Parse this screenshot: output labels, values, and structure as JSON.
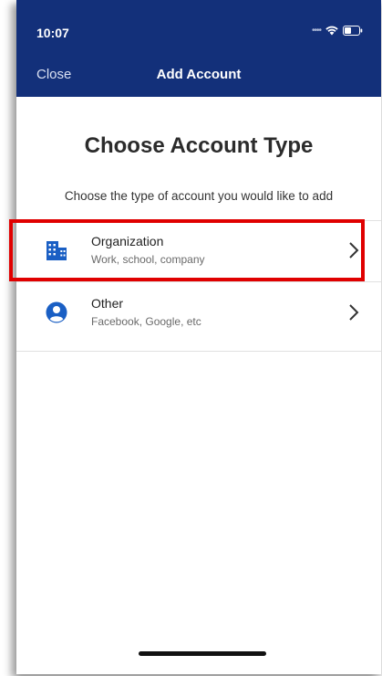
{
  "status_bar": {
    "time": "10:07"
  },
  "nav": {
    "close_label": "Close",
    "title": "Add Account"
  },
  "main": {
    "heading": "Choose Account Type",
    "subheading": "Choose the type of account you would like to add",
    "items": [
      {
        "title": "Organization",
        "subtitle": "Work, school, company",
        "icon": "building-icon",
        "highlighted": true
      },
      {
        "title": "Other",
        "subtitle": "Facebook, Google, etc",
        "icon": "person-icon",
        "highlighted": false
      }
    ]
  },
  "colors": {
    "header": "#13307a",
    "icon": "#1a5fc4",
    "highlight": "#e00000"
  }
}
